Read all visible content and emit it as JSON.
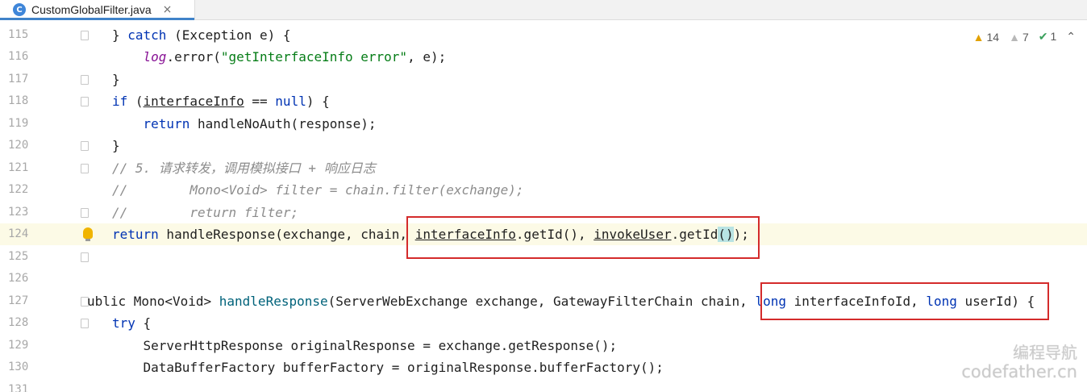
{
  "tab": {
    "icon_letter": "C",
    "filename": "CustomGlobalFilter.java",
    "close": "×"
  },
  "inspections": {
    "warnings": "14",
    "weak_warnings": "7",
    "typos": "1"
  },
  "lines": {
    "l115": {
      "num": "115",
      "p1": "} ",
      "kw1": "catch",
      "p2": " (Exception e) {"
    },
    "l116": {
      "num": "116",
      "indent": "    ",
      "fld": "log",
      "p1": ".error(",
      "str": "\"getInterfaceInfo error\"",
      "p2": ", e);"
    },
    "l117": {
      "num": "117",
      "p1": "}"
    },
    "l118": {
      "num": "118",
      "kw1": "if",
      "p1": " (",
      "ul": "interfaceInfo",
      "p2": " == ",
      "kw2": "null",
      "p3": ") {"
    },
    "l119": {
      "num": "119",
      "indent": "    ",
      "kw1": "return",
      "p1": " handleNoAuth(response);"
    },
    "l120": {
      "num": "120",
      "p1": "}"
    },
    "l121": {
      "num": "121",
      "cmt": "// 5. 请求转发，调用模拟接口 + 响应日志"
    },
    "l122": {
      "num": "122",
      "cmt": "//        Mono<Void> filter = chain.filter(exchange);"
    },
    "l123": {
      "num": "123",
      "cmt": "//        return filter;"
    },
    "l124": {
      "num": "124",
      "kw1": "return",
      "p1": " handleResponse(exchange, chain, ",
      "ul1": "interfaceInfo",
      "p2": ".getId(), ",
      "ul2": "invokeUser",
      "p3": ".getId",
      "hl": "()",
      "p4": ");"
    },
    "l125": {
      "num": "125"
    },
    "l126": {
      "num": "126"
    },
    "l127": {
      "num": "127",
      "p0": "ublic Mono<Void> ",
      "fn": "handleResponse",
      "p1": "(ServerWebExchange exchange, GatewayFilterChain chain, ",
      "kw1": "long",
      "p2": " interfaceInfoId, ",
      "kw2": "long",
      "p3": " userId) {"
    },
    "l128": {
      "num": "128",
      "kw1": "try",
      "p1": " {"
    },
    "l129": {
      "num": "129",
      "indent": "    ",
      "p1": "ServerHttpResponse originalResponse = exchange.getResponse();"
    },
    "l130": {
      "num": "130",
      "indent": "    ",
      "p1": "DataBufferFactory bufferFactory = originalResponse.bufferFactory();"
    },
    "l131": {
      "num": "131"
    }
  },
  "watermark": {
    "line1": "编程导航",
    "line2": "codefather.cn"
  }
}
